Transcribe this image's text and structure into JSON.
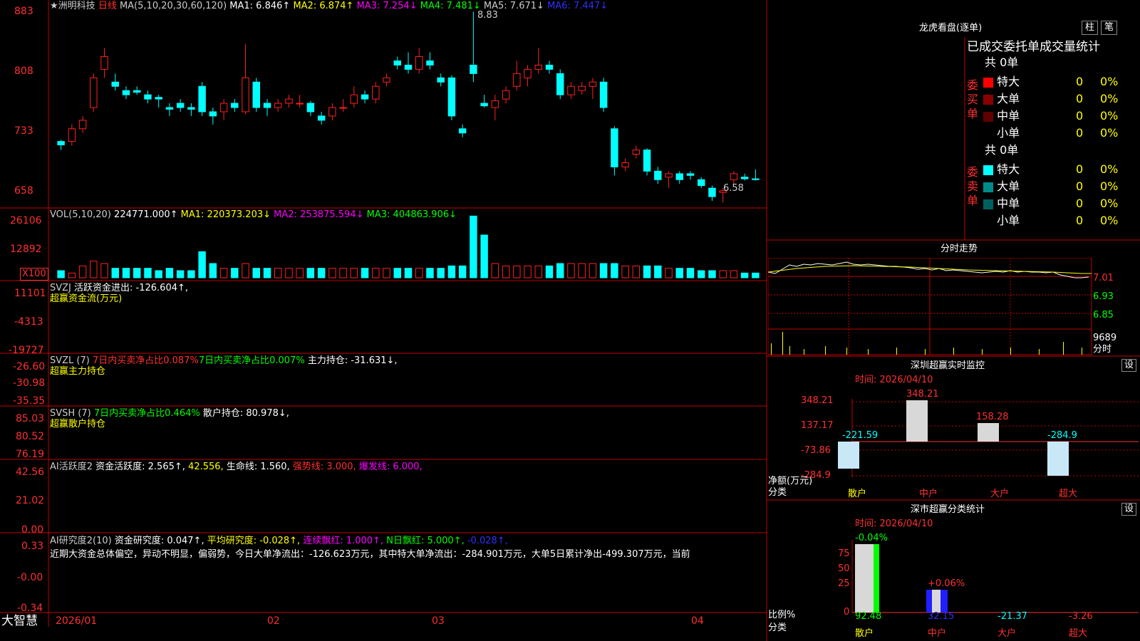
{
  "colors": {
    "up": "#ff2020",
    "down": "#00ffff",
    "grid": "#c00000",
    "white": "#ffffff",
    "yellow": "#ffff00",
    "magenta": "#ff00ff",
    "green": "#00ff00",
    "blue": "#2020ff",
    "cyan": "#00ffff"
  },
  "header": {
    "star": "★",
    "stock": "洲明科技",
    "period": "日线",
    "ma_title": "MA(5,10,20,30,60,120)",
    "ma1": "MA1: 6.846↑",
    "ma2": "MA2: 6.874↑",
    "ma3": "MA3: 7.254↓",
    "ma4": "MA4: 7.481↓",
    "ma5": "MA5: 7.671↓",
    "ma6": "MA6: 7.447↓"
  },
  "price_axis": [
    "883",
    "808",
    "733",
    "658"
  ],
  "price_annotations": {
    "high": "8.83",
    "low": "6.58"
  },
  "vol_panel": {
    "title": "VOL(5,10,20)",
    "value": "224771.000↑",
    "ma1": "MA1: 220373.203↓",
    "ma2": "MA2: 253875.594↓",
    "ma3": "MA3: 404863.906↓",
    "axis": [
      "26106",
      "12892"
    ],
    "unit": "X100"
  },
  "svzj_panel": {
    "title": "SVZJ",
    "label": "活跃资金进出: -126.604↑,",
    "subtitle": "超赢资金流(万元)",
    "axis": [
      "11101",
      "-4313",
      "-19727"
    ]
  },
  "svzl_panel": {
    "title": "SVZL (7)",
    "t1": "7日内买卖净占比0.087%",
    "t2": "7日内买卖净占比0.007%",
    "t3": "主力持仓: -31.631↓,",
    "subtitle": "超赢主力持仓",
    "axis": [
      "-26.60",
      "-30.98",
      "-35.35"
    ]
  },
  "svsh_panel": {
    "title": "SVSH (7)",
    "t1": "7日内买卖净占比0.464%",
    "t2": "散户持仓: 80.978↓,",
    "subtitle": "超赢散户持仓",
    "axis": [
      "85.03",
      "80.52",
      "76.19"
    ]
  },
  "ai_active": {
    "title": "AI活跃度2",
    "t1": "资金活跃度: 2.565↑,",
    "t2": "42.556,",
    "t3": "生命线: 1.560,",
    "t4": "强势线: 3.000,",
    "t5": "爆发线: 6.000,",
    "axis": [
      "42.56",
      "21.02",
      "0.00"
    ]
  },
  "ai_research": {
    "title": "AI研究度2(10)",
    "t1": "资金研究度: 0.047↑,",
    "t2": "平均研究度: -0.028↑,",
    "t3": "连续飘红: 1.000↑,",
    "t4": "N日飘红: 5.000↑,",
    "t5": "-0.028↑,",
    "summary": "近期大资金总体偏空，异动不明显，偏弱势，今日大单净流出：-126.623万元，其中特大单净流出：-284.901万元，大单5日累计净出-499.307万元，当前",
    "axis": [
      "0.33",
      "-0.00",
      "-0.34"
    ]
  },
  "x_axis": {
    "brand": "大智慧",
    "labels": [
      "2026/01",
      "02",
      "03",
      "04"
    ]
  },
  "dragon_tiger": {
    "title": "龙虎看盘(逐单)",
    "btn1": "柱",
    "btn2": "笔",
    "subtitle": "已成交委托单成交量统计",
    "buy_side": "委买单",
    "sell_side": "委卖单",
    "buy_total": "共 0单",
    "sell_total": "共 0单",
    "rows": [
      {
        "label": "特大",
        "v": "0",
        "p": "0%"
      },
      {
        "label": "大单",
        "v": "0",
        "p": "0%"
      },
      {
        "label": "中单",
        "v": "0",
        "p": "0%"
      },
      {
        "label": "小单",
        "v": "0",
        "p": "0%"
      }
    ]
  },
  "intraday": {
    "title": "分时走势",
    "axis": [
      "7.01",
      "6.93",
      "6.85"
    ],
    "vol_max": "9689",
    "footer": "分时"
  },
  "sz_monitor": {
    "title": "深圳超赢实时监控",
    "btn": "设",
    "time": "时间: 2026/04/10",
    "axis": [
      "348.21",
      "137.17",
      "-73.86",
      "-284.9"
    ],
    "unit1": "净额(万元)",
    "unit2": "分类",
    "cats": [
      "散户",
      "中户",
      "大户",
      "超大"
    ],
    "vals": [
      "-221.59",
      "348.21",
      "158.28",
      "-284.9"
    ]
  },
  "sz_class": {
    "title": "深市超赢分类统计",
    "btn": "设",
    "time": "时间: 2026/04/10",
    "axis": [
      "75",
      "50",
      "25",
      "0"
    ],
    "unit1": "比例%",
    "unit2": "分类",
    "cats": [
      "散户",
      "中户",
      "大户",
      "超大"
    ],
    "vals": [
      "92.48",
      "32.15",
      "-21.37",
      "-3.26"
    ],
    "top1": "-0.04%",
    "top2": "+0.06%"
  },
  "chart_data": {
    "type": "candlestick",
    "title": "洲明科技 日线",
    "ylim": [
      6.55,
      8.9
    ],
    "x_labels": [
      "2026/01",
      "02",
      "03",
      "04"
    ],
    "candles": [
      {
        "o": 7.3,
        "c": 7.26,
        "h": 7.32,
        "l": 7.2
      },
      {
        "o": 7.3,
        "c": 7.45,
        "h": 7.5,
        "l": 7.25
      },
      {
        "o": 7.45,
        "c": 7.55,
        "h": 7.6,
        "l": 7.4
      },
      {
        "o": 7.7,
        "c": 8.05,
        "h": 8.1,
        "l": 7.65
      },
      {
        "o": 8.15,
        "c": 8.3,
        "h": 8.4,
        "l": 8.05
      },
      {
        "o": 8.0,
        "c": 7.95,
        "h": 8.1,
        "l": 7.9
      },
      {
        "o": 7.9,
        "c": 7.85,
        "h": 7.95,
        "l": 7.8
      },
      {
        "o": 7.9,
        "c": 7.88,
        "h": 7.95,
        "l": 7.85
      },
      {
        "o": 7.85,
        "c": 7.8,
        "h": 7.9,
        "l": 7.75
      },
      {
        "o": 7.82,
        "c": 7.8,
        "h": 7.85,
        "l": 7.7
      },
      {
        "o": 7.7,
        "c": 7.68,
        "h": 7.75,
        "l": 7.6
      },
      {
        "o": 7.75,
        "c": 7.7,
        "h": 7.8,
        "l": 7.65
      },
      {
        "o": 7.7,
        "c": 7.68,
        "h": 7.75,
        "l": 7.6
      },
      {
        "o": 7.95,
        "c": 7.65,
        "h": 8.0,
        "l": 7.6
      },
      {
        "o": 7.65,
        "c": 7.6,
        "h": 7.7,
        "l": 7.5
      },
      {
        "o": 7.65,
        "c": 7.75,
        "h": 7.8,
        "l": 7.55
      },
      {
        "o": 7.75,
        "c": 7.7,
        "h": 7.8,
        "l": 7.65
      },
      {
        "o": 7.65,
        "c": 8.05,
        "h": 8.45,
        "l": 7.62
      },
      {
        "o": 8.0,
        "c": 7.7,
        "h": 8.05,
        "l": 7.65
      },
      {
        "o": 7.75,
        "c": 7.7,
        "h": 7.8,
        "l": 7.6
      },
      {
        "o": 7.7,
        "c": 7.75,
        "h": 7.8,
        "l": 7.65
      },
      {
        "o": 7.75,
        "c": 7.8,
        "h": 7.85,
        "l": 7.7
      },
      {
        "o": 7.75,
        "c": 7.75,
        "h": 7.85,
        "l": 7.7
      },
      {
        "o": 7.75,
        "c": 7.65,
        "h": 7.78,
        "l": 7.6
      },
      {
        "o": 7.6,
        "c": 7.55,
        "h": 7.65,
        "l": 7.5
      },
      {
        "o": 7.6,
        "c": 7.7,
        "h": 7.75,
        "l": 7.55
      },
      {
        "o": 7.7,
        "c": 7.7,
        "h": 7.8,
        "l": 7.65
      },
      {
        "o": 7.75,
        "c": 7.85,
        "h": 7.95,
        "l": 7.7
      },
      {
        "o": 7.85,
        "c": 7.8,
        "h": 7.9,
        "l": 7.75
      },
      {
        "o": 7.8,
        "c": 7.95,
        "h": 8.0,
        "l": 7.75
      },
      {
        "o": 8.0,
        "c": 8.05,
        "h": 8.1,
        "l": 7.95
      },
      {
        "o": 8.25,
        "c": 8.2,
        "h": 8.3,
        "l": 8.15
      },
      {
        "o": 8.2,
        "c": 8.15,
        "h": 8.35,
        "l": 8.1
      },
      {
        "o": 8.15,
        "c": 8.3,
        "h": 8.4,
        "l": 8.1
      },
      {
        "o": 8.25,
        "c": 8.2,
        "h": 8.35,
        "l": 8.15
      },
      {
        "o": 8.05,
        "c": 8.0,
        "h": 8.1,
        "l": 7.95
      },
      {
        "o": 8.05,
        "c": 7.6,
        "h": 8.08,
        "l": 7.55
      },
      {
        "o": 7.45,
        "c": 7.4,
        "h": 7.5,
        "l": 7.35
      },
      {
        "o": 8.2,
        "c": 8.1,
        "h": 8.83,
        "l": 8.0
      },
      {
        "o": 7.75,
        "c": 7.72,
        "h": 7.85,
        "l": 7.7
      },
      {
        "o": 7.7,
        "c": 7.78,
        "h": 7.85,
        "l": 7.55
      },
      {
        "o": 7.8,
        "c": 7.9,
        "h": 7.95,
        "l": 7.75
      },
      {
        "o": 7.95,
        "c": 8.1,
        "h": 8.25,
        "l": 7.9
      },
      {
        "o": 8.05,
        "c": 8.15,
        "h": 8.2,
        "l": 7.95
      },
      {
        "o": 8.15,
        "c": 8.2,
        "h": 8.4,
        "l": 8.1
      },
      {
        "o": 8.2,
        "c": 8.15,
        "h": 8.25,
        "l": 8.1
      },
      {
        "o": 8.1,
        "c": 7.85,
        "h": 8.15,
        "l": 7.8
      },
      {
        "o": 7.85,
        "c": 7.95,
        "h": 8.0,
        "l": 7.8
      },
      {
        "o": 7.9,
        "c": 7.95,
        "h": 8.0,
        "l": 7.85
      },
      {
        "o": 7.95,
        "c": 8.0,
        "h": 8.05,
        "l": 7.8
      },
      {
        "o": 8.0,
        "c": 7.7,
        "h": 8.05,
        "l": 7.65
      },
      {
        "o": 7.45,
        "c": 7.0,
        "h": 7.48,
        "l": 6.9
      },
      {
        "o": 7.0,
        "c": 7.05,
        "h": 7.1,
        "l": 6.95
      },
      {
        "o": 7.15,
        "c": 7.2,
        "h": 7.25,
        "l": 7.1
      },
      {
        "o": 7.2,
        "c": 6.95,
        "h": 7.22,
        "l": 6.9
      },
      {
        "o": 6.95,
        "c": 6.85,
        "h": 7.0,
        "l": 6.8
      },
      {
        "o": 6.88,
        "c": 6.92,
        "h": 6.95,
        "l": 6.75
      },
      {
        "o": 6.92,
        "c": 6.85,
        "h": 6.95,
        "l": 6.8
      },
      {
        "o": 6.92,
        "c": 6.9,
        "h": 6.95,
        "l": 6.85
      },
      {
        "o": 6.85,
        "c": 6.78,
        "h": 6.88,
        "l": 6.75
      },
      {
        "o": 6.75,
        "c": 6.65,
        "h": 6.78,
        "l": 6.6
      },
      {
        "o": 6.7,
        "c": 6.72,
        "h": 6.75,
        "l": 6.58
      },
      {
        "o": 6.85,
        "c": 6.92,
        "h": 6.95,
        "l": 6.8
      },
      {
        "o": 6.88,
        "c": 6.86,
        "h": 6.92,
        "l": 6.84
      },
      {
        "o": 6.86,
        "c": 6.85,
        "h": 6.97,
        "l": 6.84
      }
    ],
    "volumes": [
      3,
      2,
      5,
      7,
      6,
      4,
      4,
      4,
      4,
      3,
      4,
      3,
      3,
      11,
      6,
      4,
      4,
      6,
      4,
      4,
      4,
      4,
      4,
      4,
      4,
      4,
      4,
      4,
      4,
      4,
      4,
      4,
      4,
      4,
      4,
      4,
      5,
      5,
      26,
      18,
      6,
      5,
      5,
      5,
      5,
      5,
      6,
      6,
      6,
      6,
      6,
      6,
      5,
      5,
      5,
      5,
      4,
      4,
      4,
      3,
      3,
      3,
      3,
      2,
      2
    ],
    "vol_ylim": [
      0,
      27
    ]
  }
}
